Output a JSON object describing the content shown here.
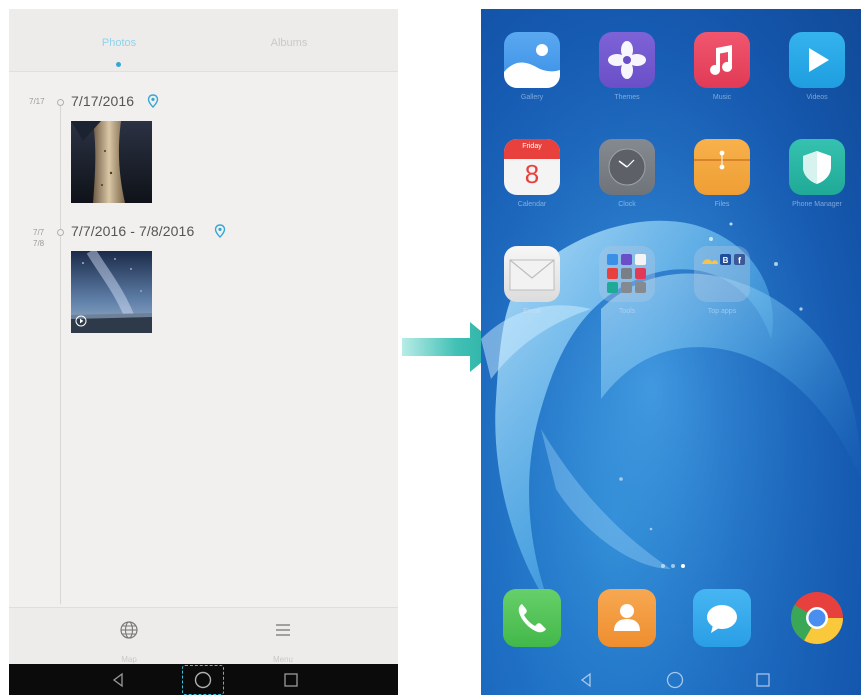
{
  "gallery": {
    "tabs": [
      {
        "label": "Photos",
        "active": true
      },
      {
        "label": "Albums",
        "active": false
      }
    ],
    "groups": [
      {
        "short_date": "7/17",
        "short_date_2": "",
        "title": "7/17/2016",
        "has_location": true,
        "is_video": false
      },
      {
        "short_date": "7/7",
        "short_date_2": "7/8",
        "title": "7/7/2016 - 7/8/2016",
        "has_location": true,
        "is_video": true
      }
    ],
    "bottom_bar": {
      "map_label": "Map",
      "menu_label": "Menu"
    },
    "accent_color": "#36a6d6"
  },
  "home": {
    "apps_row1": [
      {
        "label": "Gallery",
        "icon": "gallery-icon"
      },
      {
        "label": "Themes",
        "icon": "themes-icon"
      },
      {
        "label": "Music",
        "icon": "music-icon"
      },
      {
        "label": "Videos",
        "icon": "videos-icon"
      }
    ],
    "apps_row2": [
      {
        "label": "Calendar",
        "icon": "calendar-icon",
        "day_name": "Friday",
        "day_number": "8"
      },
      {
        "label": "Clock",
        "icon": "clock-icon"
      },
      {
        "label": "Files",
        "icon": "files-icon"
      },
      {
        "label": "Phone Manager",
        "icon": "phone-manager-icon"
      }
    ],
    "apps_row3": [
      {
        "label": "Email",
        "icon": "email-icon"
      },
      {
        "label": "Tools",
        "icon": "folder-icon"
      },
      {
        "label": "Top apps",
        "icon": "folder-icon"
      }
    ],
    "dock": [
      {
        "label": "Phone",
        "icon": "phone-icon"
      },
      {
        "label": "Contacts",
        "icon": "contacts-icon"
      },
      {
        "label": "Messaging",
        "icon": "messaging-icon"
      },
      {
        "label": "Chrome",
        "icon": "chrome-icon"
      }
    ],
    "page_count": 3,
    "active_page": 3
  },
  "navigation": [
    "back",
    "home",
    "recents"
  ]
}
